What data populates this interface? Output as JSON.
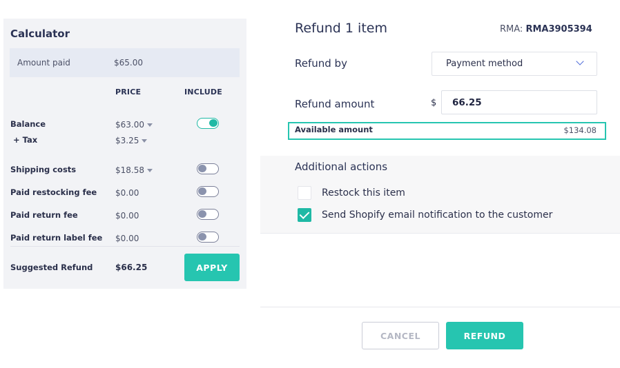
{
  "calculator": {
    "title": "Calculator",
    "amount_paid_label": "Amount paid",
    "amount_paid_value": "$65.00",
    "col_price": "PRICE",
    "col_include": "INCLUDE",
    "rows": [
      {
        "label": "Balance",
        "price": "$63.00",
        "include": true
      },
      {
        "label": "+ Tax",
        "price": "$3.25"
      },
      {
        "label": "Shipping costs",
        "price": "$18.58",
        "include": false
      },
      {
        "label": "Paid restocking fee",
        "price": "$0.00",
        "include": false
      },
      {
        "label": "Paid return fee",
        "price": "$0.00",
        "include": false
      },
      {
        "label": "Paid return label fee",
        "price": "$0.00",
        "include": false
      }
    ],
    "suggested_label": "Suggested Refund",
    "suggested_value": "$66.25",
    "apply_label": "APPLY"
  },
  "refund": {
    "title": "Refund 1 item",
    "rma_label": "RMA:",
    "rma_value": "RMA3905394",
    "refund_by_label": "Refund by",
    "refund_by_value": "Payment method",
    "amount_label": "Refund amount",
    "currency": "$",
    "amount_value": "66.25",
    "available_label": "Available amount",
    "available_value": "$134.08"
  },
  "additional_actions": {
    "title": "Additional actions",
    "items": [
      {
        "label": "Restock this item",
        "checked": false
      },
      {
        "label": "Send Shopify email notification to the customer",
        "checked": true
      }
    ]
  },
  "footer": {
    "cancel_label": "CANCEL",
    "refund_label": "REFUND"
  },
  "colors": {
    "accent": "#26c5b0",
    "panel_bg": "#f2f3f6",
    "text_dark": "#2b3355"
  }
}
